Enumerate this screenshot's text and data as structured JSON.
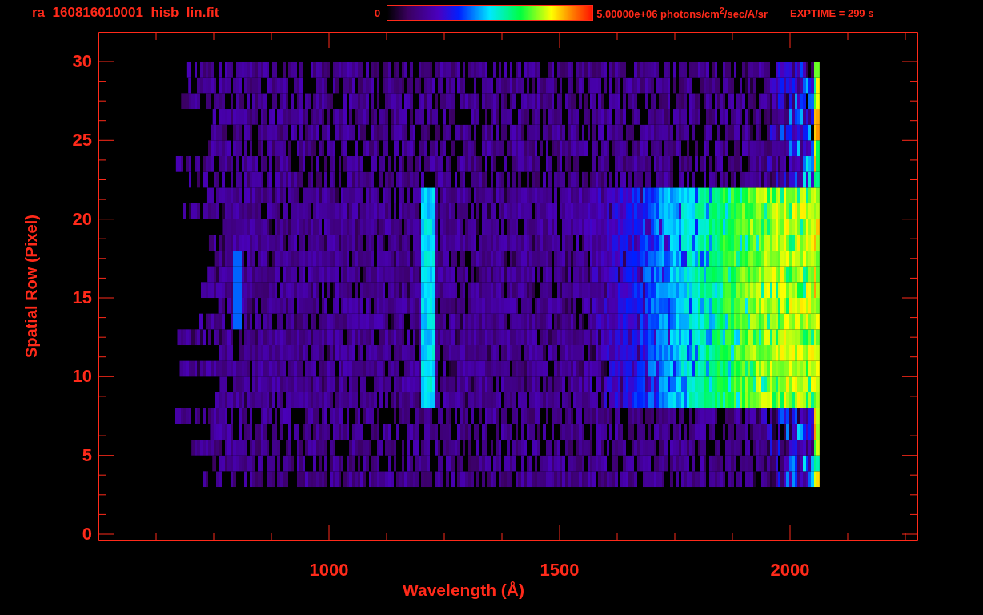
{
  "title": "ra_160816010001_hisb_lin.fit",
  "colorbar": {
    "min_label": "0",
    "max_label": "5.00000e+06 photons/cm$^{2}$/sec/A/sr"
  },
  "exptime": "EXPTIME = 299 s",
  "plot": {
    "xlabel": "Wavelength (Å)",
    "ylabel": "Spatial Row (Pixel)",
    "xticks": [
      "1000",
      "1500",
      "2000"
    ],
    "yticks": [
      "30",
      "25",
      "20",
      "15",
      "10",
      "5",
      "0"
    ]
  }
}
